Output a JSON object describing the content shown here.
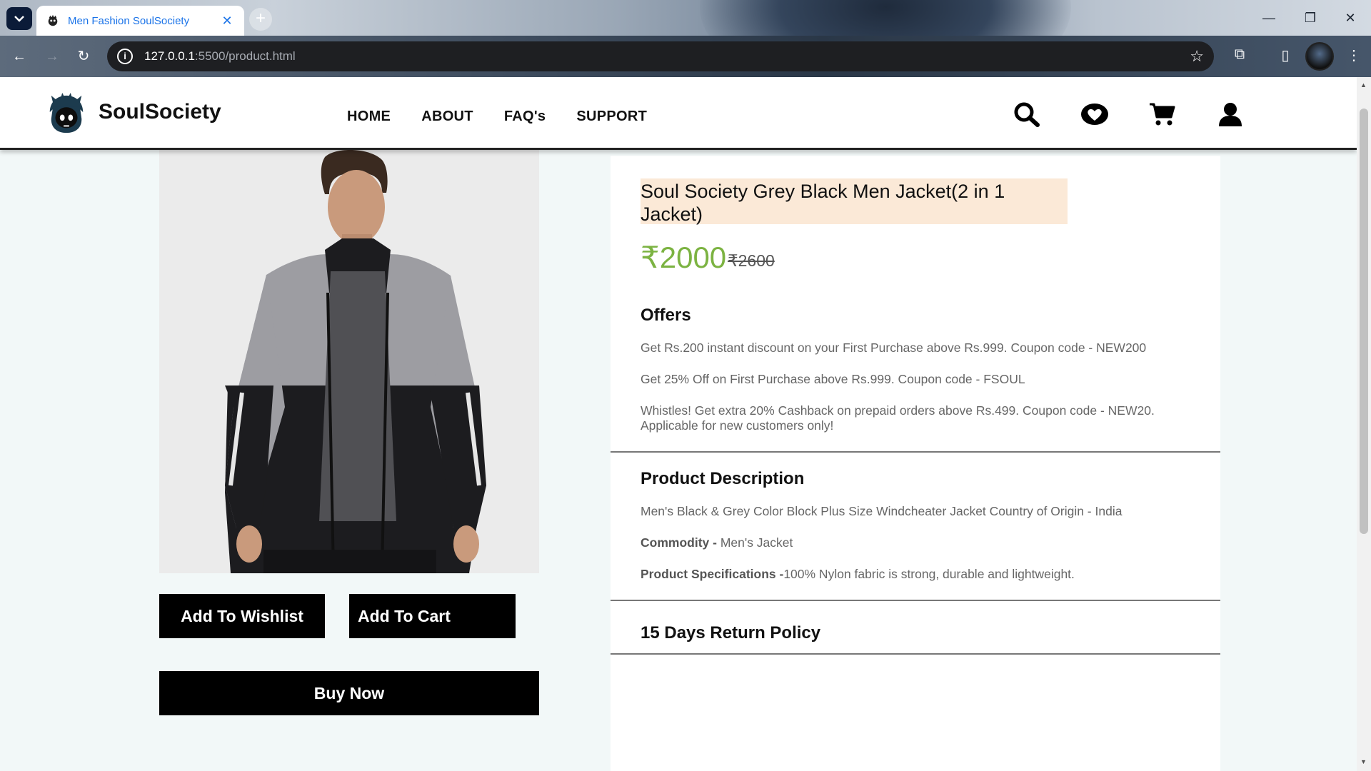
{
  "browser": {
    "tab_title": "Men Fashion SoulSociety",
    "url_host": "127.0.0.1",
    "url_rest": ":5500/product.html"
  },
  "site": {
    "brand": "SoulSociety",
    "nav": [
      "HOME",
      "ABOUT",
      "FAQ's",
      "SUPPORT"
    ],
    "icons": [
      "search-icon",
      "heart-icon",
      "cart-icon",
      "user-icon"
    ]
  },
  "product": {
    "title": "Soul Society Grey Black Men Jacket(2 in 1 Jacket)",
    "price": "₹2000",
    "old_price": "₹2600",
    "buttons": {
      "wishlist": "Add To Wishlist",
      "cart": "Add To Cart",
      "buy": "Buy Now"
    },
    "offers_heading": "Offers",
    "offers": [
      "Get Rs.200 instant discount on your First Purchase above Rs.999. Coupon code - NEW200",
      "Get 25% Off on First Purchase above Rs.999. Coupon code - FSOUL",
      "Whistles! Get extra 20% Cashback on prepaid orders above Rs.499. Coupon code - NEW20. Applicable for new customers only!"
    ],
    "description_heading": "Product Description",
    "description": "Men's Black & Grey Color Block Plus Size Windcheater Jacket Country of Origin - India",
    "commodity_label": "Commodity -",
    "commodity_value": " Men's Jacket",
    "spec_label": "Product Specifications -",
    "spec_value": "100% Nylon fabric is strong, durable and lightweight.",
    "return_policy": "15 Days Return Policy"
  },
  "colors": {
    "price_green": "#7cb342",
    "title_highlight": "#fbe9d7",
    "button_black": "#000000"
  }
}
